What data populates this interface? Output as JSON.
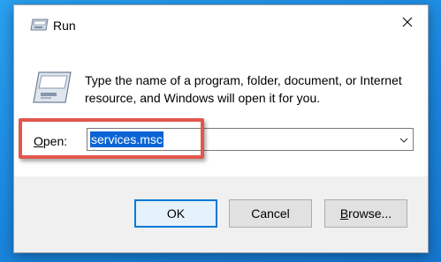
{
  "window": {
    "title": "Run",
    "close_icon": "close-icon",
    "app_icon": "run-app-icon"
  },
  "content": {
    "description": "Type the name of a program, folder, document, or Internet resource, and Windows will open it for you.",
    "icon": "run-dialog-icon"
  },
  "open_field": {
    "label_mnemonic": "O",
    "label_rest": "pen:",
    "value": "services.msc",
    "dropdown_icon": "chevron-down-icon"
  },
  "buttons": {
    "ok_label": "OK",
    "cancel_label": "Cancel",
    "browse_mnemonic": "B",
    "browse_rest": "rowse..."
  },
  "colors": {
    "selection": "#0a64d6",
    "highlight_box": "#e2574c",
    "default_button_border": "#0078d7",
    "desktop": "#1f8fe6"
  }
}
